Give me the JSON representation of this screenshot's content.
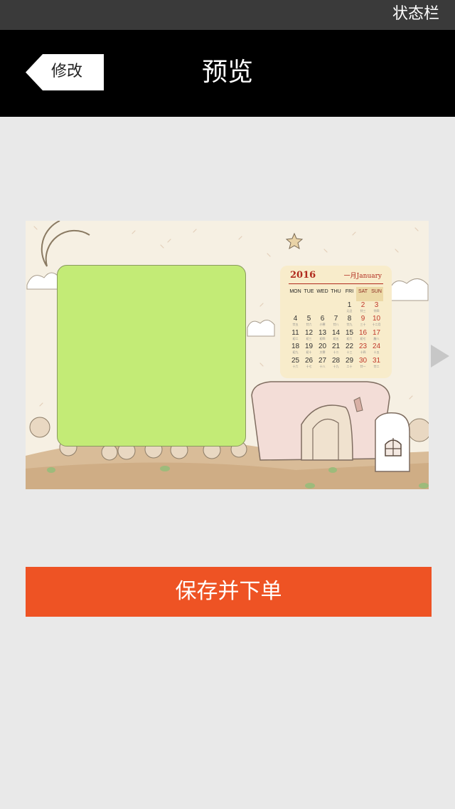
{
  "status_bar": {
    "text": "状态栏"
  },
  "header": {
    "back_label": "修改",
    "title": "预览"
  },
  "calendar": {
    "year": "2016",
    "month": "一月January",
    "weekdays": [
      "MON",
      "TUE",
      "WED",
      "THU",
      "FRI",
      "SAT",
      "SUN"
    ],
    "weeks": [
      [
        null,
        null,
        null,
        null,
        {
          "d": "1",
          "l": "元旦"
        },
        {
          "d": "2",
          "l": "廿三"
        },
        {
          "d": "3",
          "l": "廿四"
        }
      ],
      [
        {
          "d": "4",
          "l": "廿五"
        },
        {
          "d": "5",
          "l": "廿六"
        },
        {
          "d": "6",
          "l": "小寒"
        },
        {
          "d": "7",
          "l": "廿八"
        },
        {
          "d": "8",
          "l": "廿九"
        },
        {
          "d": "9",
          "l": "三十"
        },
        {
          "d": "10",
          "l": "十二月"
        }
      ],
      [
        {
          "d": "11",
          "l": "初二"
        },
        {
          "d": "12",
          "l": "初三"
        },
        {
          "d": "13",
          "l": "初四"
        },
        {
          "d": "14",
          "l": "初五"
        },
        {
          "d": "15",
          "l": "初六"
        },
        {
          "d": "16",
          "l": "初七"
        },
        {
          "d": "17",
          "l": "腊八"
        }
      ],
      [
        {
          "d": "18",
          "l": "初九"
        },
        {
          "d": "19",
          "l": "初十"
        },
        {
          "d": "20",
          "l": "大寒"
        },
        {
          "d": "21",
          "l": "十二"
        },
        {
          "d": "22",
          "l": "十三"
        },
        {
          "d": "23",
          "l": "十四"
        },
        {
          "d": "24",
          "l": "十五"
        }
      ],
      [
        {
          "d": "25",
          "l": "十六"
        },
        {
          "d": "26",
          "l": "十七"
        },
        {
          "d": "27",
          "l": "十八"
        },
        {
          "d": "28",
          "l": "十九"
        },
        {
          "d": "29",
          "l": "二十"
        },
        {
          "d": "30",
          "l": "廿一"
        },
        {
          "d": "31",
          "l": "廿二"
        }
      ]
    ]
  },
  "actions": {
    "save_label": "保存并下单"
  },
  "colors": {
    "accent": "#ee5324",
    "header_bg": "#000000",
    "photo_slot": "#c3eb76",
    "calendar_red": "#b02a1d"
  }
}
